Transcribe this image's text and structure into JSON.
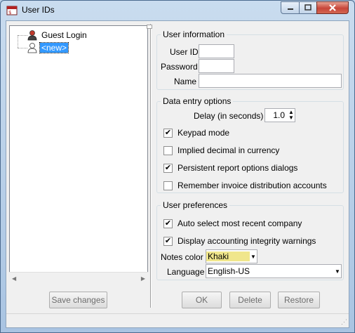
{
  "window": {
    "title": "User IDs"
  },
  "tree": {
    "items": [
      {
        "label": "Guest Login",
        "icon": "user-icon"
      },
      {
        "label": "<new>",
        "icon": "new-user-icon",
        "selected": true
      }
    ]
  },
  "buttons": {
    "save_changes": "Save changes",
    "ok": "OK",
    "delete": "Delete",
    "restore": "Restore"
  },
  "user_information": {
    "legend": "User information",
    "user_id_label": "User ID",
    "user_id_value": "",
    "password_label": "Password",
    "password_value": "",
    "name_label": "Name",
    "name_value": ""
  },
  "data_entry_options": {
    "legend": "Data entry options",
    "delay_label": "Delay (in seconds)",
    "delay_value": "1.0",
    "keypad_mode": {
      "label": "Keypad mode",
      "checked": true
    },
    "implied_decimal": {
      "label": "Implied decimal in currency",
      "checked": false
    },
    "persistent_report": {
      "label": "Persistent report options dialogs",
      "checked": true
    },
    "remember_invoice": {
      "label": "Remember invoice distribution accounts",
      "checked": false
    }
  },
  "user_preferences": {
    "legend": "User preferences",
    "auto_select": {
      "label": "Auto select most recent company",
      "checked": true
    },
    "display_integrity": {
      "label": "Display accounting integrity warnings",
      "checked": true
    },
    "notes_color_label": "Notes color",
    "notes_color_value": "Khaki",
    "notes_color_hex": "#f0e68c",
    "language_label": "Language",
    "language_value": "English-US"
  },
  "colors": {
    "selection": "#3399ff",
    "close_button": "#c7463a"
  }
}
